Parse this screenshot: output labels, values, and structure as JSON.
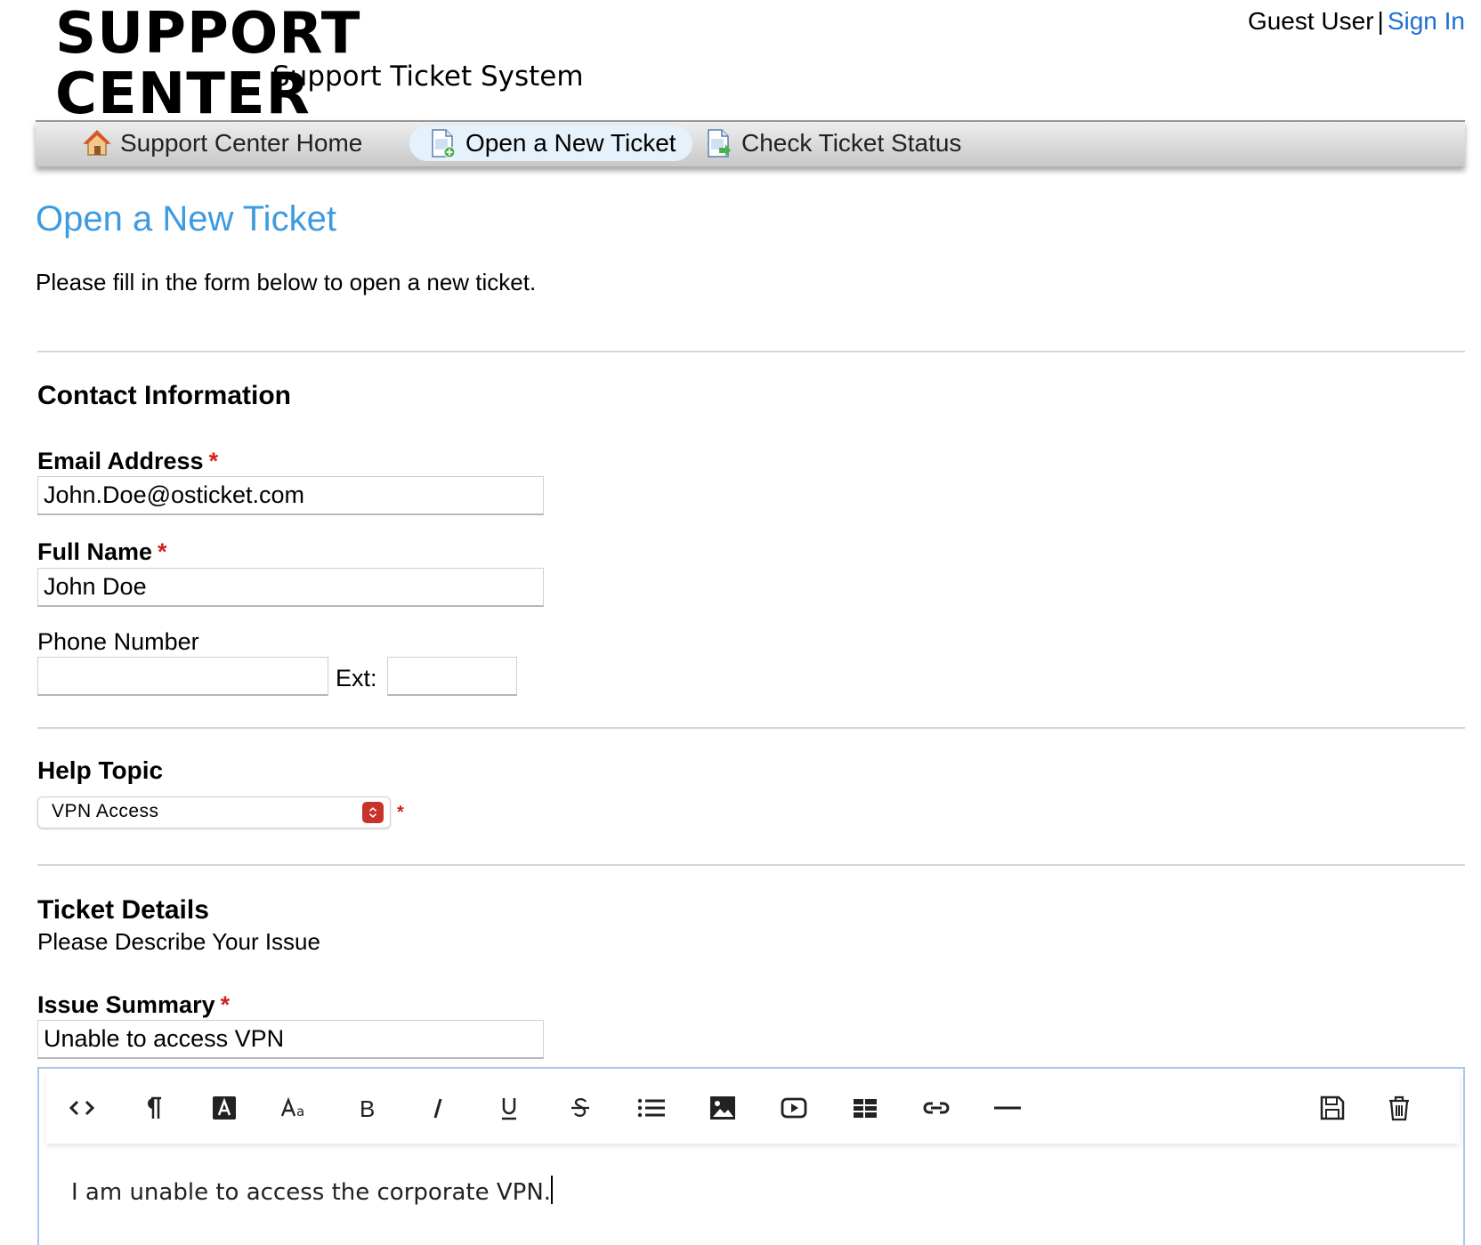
{
  "header": {
    "logo_title": "SUPPORT CENTER",
    "logo_subtitle": "Support Ticket System",
    "user_label": "Guest User",
    "separator": "|",
    "sign_in": "Sign In"
  },
  "nav": {
    "items": [
      {
        "label": "Support Center Home",
        "icon": "home-icon",
        "active": false
      },
      {
        "label": "Open a New Ticket",
        "icon": "new-ticket-icon",
        "active": true
      },
      {
        "label": "Check Ticket Status",
        "icon": "ticket-status-icon",
        "active": false
      }
    ]
  },
  "page": {
    "title": "Open a New Ticket",
    "intro": "Please fill in the form below to open a new ticket."
  },
  "contact": {
    "heading": "Contact Information",
    "email_label": "Email Address",
    "email_value": "John.Doe@osticket.com",
    "name_label": "Full Name",
    "name_value": "John Doe",
    "phone_label": "Phone Number",
    "phone_value": "",
    "ext_label": "Ext:",
    "ext_value": "",
    "required_mark": "*"
  },
  "help_topic": {
    "heading": "Help Topic",
    "selected": "VPN Access",
    "required_mark": "*"
  },
  "details": {
    "heading": "Ticket Details",
    "subheading": "Please Describe Your Issue",
    "summary_label": "Issue Summary",
    "summary_value": "Unable to access VPN",
    "required_mark": "*",
    "body_text": "I am unable to access the corporate VPN."
  },
  "editor": {
    "toolbar": [
      "code-view-icon",
      "paragraph-format-icon",
      "text-color-icon",
      "font-size-icon",
      "bold-icon",
      "italic-icon",
      "underline-icon",
      "strikethrough-icon",
      "unordered-list-icon",
      "insert-image-icon",
      "insert-video-icon",
      "insert-table-icon",
      "insert-link-icon",
      "horizontal-rule-icon",
      "save-draft-icon",
      "delete-draft-icon"
    ]
  },
  "colors": {
    "accent": "#3d9be0",
    "link": "#1f6fd1",
    "required": "#d0231e",
    "active_tab": "#e5f1fb"
  }
}
